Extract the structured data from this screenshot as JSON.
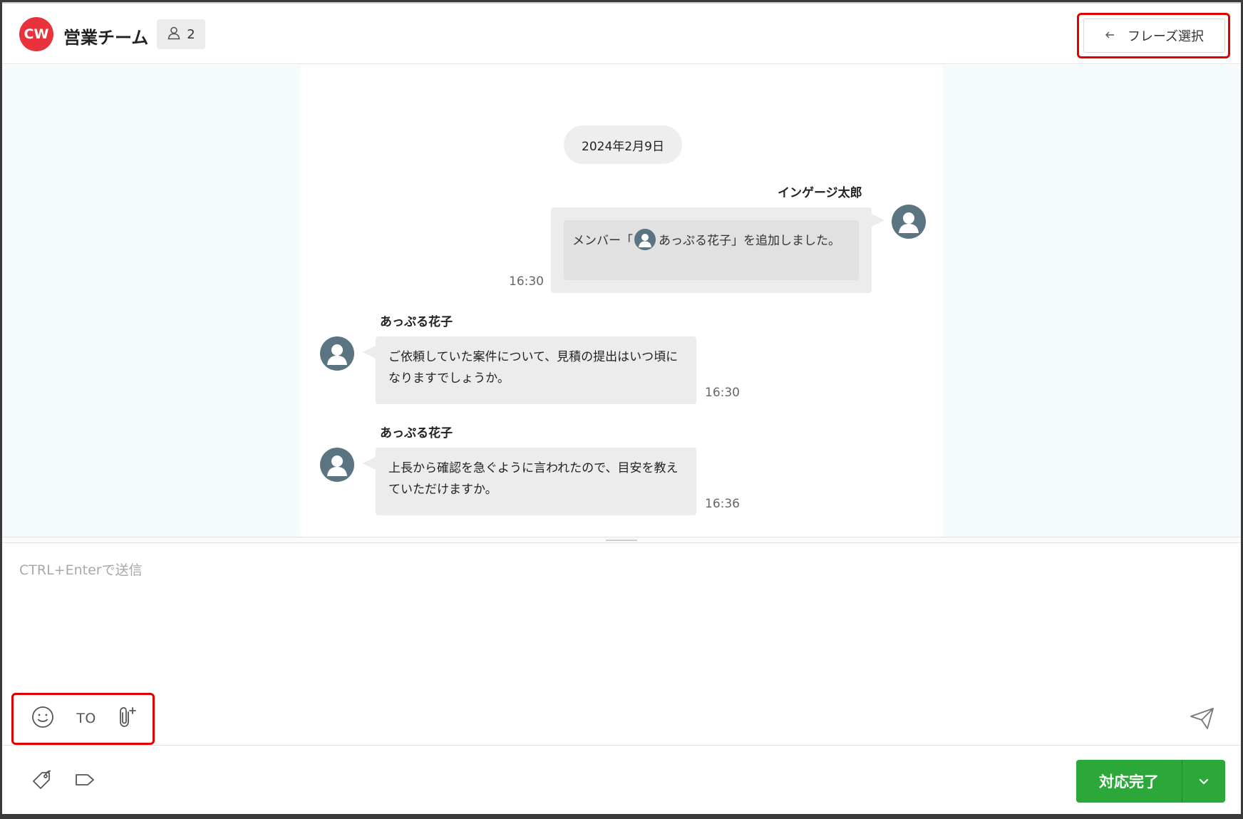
{
  "header": {
    "logo_text": "CW",
    "room_title": "営業チーム",
    "member_count": "2",
    "phrase_button_label": "フレーズ選択"
  },
  "messages": {
    "date": "2024年2月9日",
    "items": [
      {
        "sender": "インゲージ太郎",
        "text_before": "メンバー「",
        "mention": "あっぷる花子",
        "text_after": "」を追加しました。",
        "time": "16:30"
      },
      {
        "sender": "あっぷる花子",
        "text": "ご依頼していた案件について、見積の提出はいつ頃になりますでしょうか。",
        "time": "16:30"
      },
      {
        "sender": "あっぷる花子",
        "text": "上長から確認を急ぐように言われたので、目安を教えていただけますか。",
        "time": "16:36"
      }
    ]
  },
  "composer": {
    "placeholder": "CTRL+Enterで送信",
    "to_label": "TO"
  },
  "footer": {
    "complete_label": "対応完了"
  },
  "colors": {
    "logo": "#e8323c",
    "highlight": "#e00000",
    "complete": "#2ca73a",
    "avatar": "#5b7482"
  }
}
